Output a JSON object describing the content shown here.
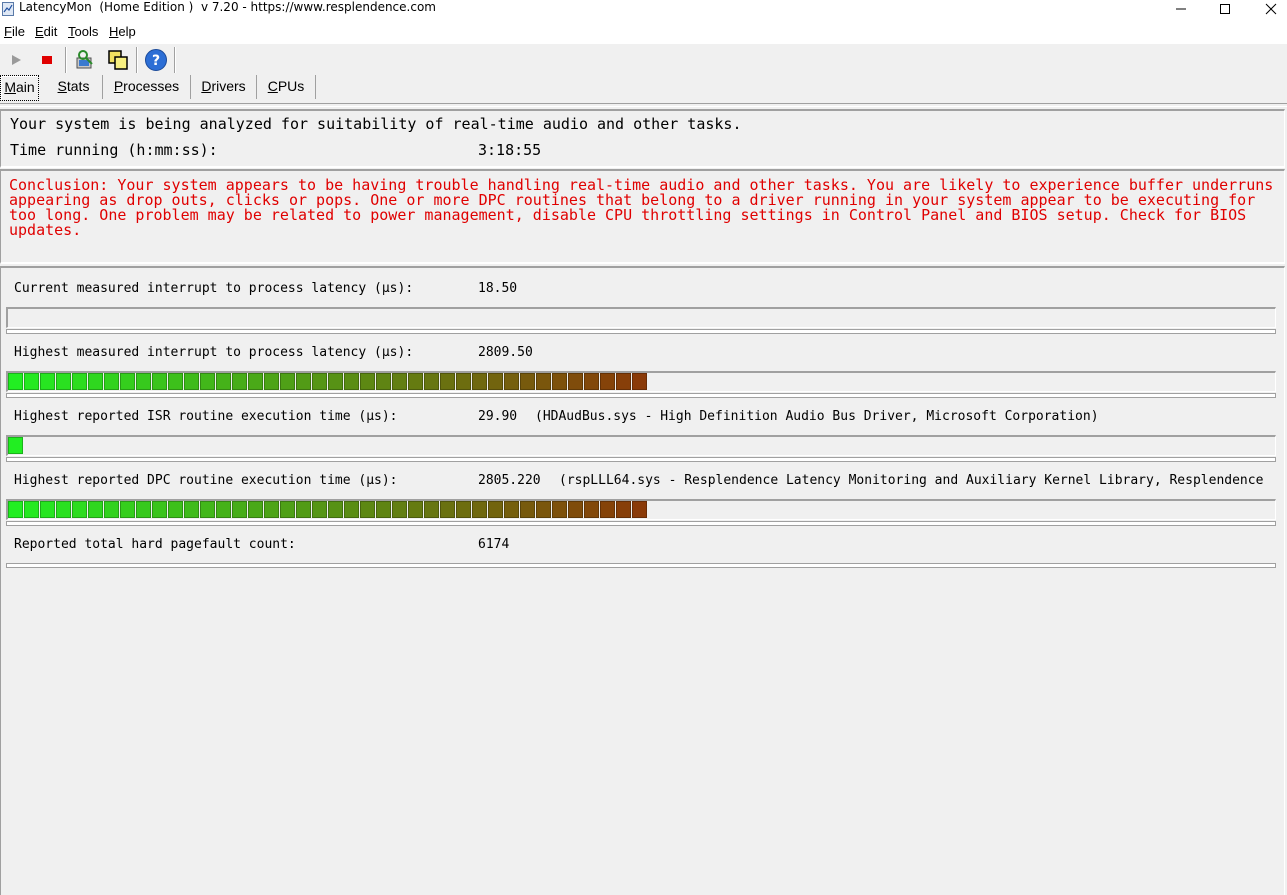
{
  "window": {
    "title": "LatencyMon  (Home Edition )  v 7.20 - https://www.resplendence.com",
    "minimize_icon": "minimize-icon",
    "maximize_icon": "maximize-icon",
    "close_icon": "close-icon"
  },
  "menu": {
    "items": [
      {
        "accel": "F",
        "rest": "ile"
      },
      {
        "accel": "E",
        "rest": "dit"
      },
      {
        "accel": "T",
        "rest": "ools"
      },
      {
        "accel": "H",
        "rest": "elp"
      }
    ]
  },
  "toolbar": {
    "buttons": [
      {
        "icon": "play-icon",
        "enabled": false
      },
      {
        "icon": "stop-icon",
        "enabled": true
      },
      {
        "icon": "analyze-icon",
        "enabled": true
      },
      {
        "icon": "windows-icon",
        "enabled": true
      },
      {
        "icon": "help-icon",
        "enabled": true
      }
    ]
  },
  "tabs": [
    {
      "accel": "M",
      "rest": "ain",
      "active": true
    },
    {
      "accel": "S",
      "rest": "tats",
      "active": false
    },
    {
      "accel": "P",
      "rest": "rocesses",
      "active": false
    },
    {
      "accel": "D",
      "rest": "rivers",
      "active": false
    },
    {
      "accel": "C",
      "rest": "PUs",
      "active": false
    }
  ],
  "status": {
    "line1": "Your system is being analyzed for suitability of real-time audio and other tasks.",
    "time_label": "Time running (h:mm:ss):",
    "time_value": "3:18:55"
  },
  "conclusion": "Conclusion: Your system appears to be having trouble handling real-time audio and other tasks. You are likely to experience buffer underruns appearing as drop outs, clicks or pops. One or more DPC routines that belong to a driver running in your system appear to be executing for too long. One problem may be related to power management, disable CPU throttling settings in Control Panel and BIOS setup. Check for BIOS updates.",
  "metrics": [
    {
      "label": "Current measured interrupt to process latency (µs):",
      "value": "18.50",
      "detail": "",
      "bar_segments": 0
    },
    {
      "label": "Highest measured interrupt to process latency (µs):",
      "value": "2809.50",
      "detail": "",
      "bar_segments": 40
    },
    {
      "label": "Highest reported ISR routine execution time (µs):",
      "value": "29.90",
      "detail": "(HDAudBus.sys - High Definition Audio Bus Driver, Microsoft Corporation)",
      "bar_segments": 1
    },
    {
      "label": "Highest reported DPC routine execution time (µs):",
      "value": "2805.220",
      "detail": "(rspLLL64.sys - Resplendence Latency Monitoring and Auxiliary Kernel Library, Resplendence",
      "bar_segments": 40
    }
  ],
  "pagefault": {
    "label": "Reported total hard pagefault count:",
    "value": "6174"
  },
  "colors": {
    "conclusion_text": "#e00000",
    "bar_start": "#22ee22",
    "bar_end": "#8a3a08"
  }
}
